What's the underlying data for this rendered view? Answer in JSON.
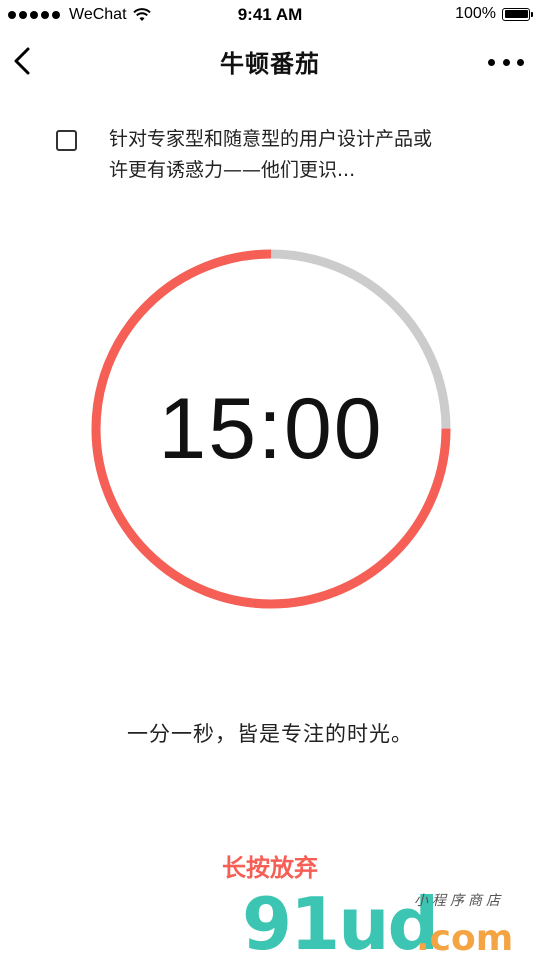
{
  "status_bar": {
    "carrier": "WeChat",
    "time": "9:41 AM",
    "battery": "100%"
  },
  "nav": {
    "title": "牛顿番茄",
    "back_icon": "chevron-left-icon",
    "more_icon": "ellipsis-icon"
  },
  "task": {
    "text": "针对专家型和随意型的用户设计产品或许更有诱惑力——他们更识...",
    "checked": false
  },
  "timer": {
    "display": "15:00",
    "progress_fraction": 0.75,
    "colors": {
      "progress": "#f65f55",
      "track": "#cccccc"
    }
  },
  "motto": "一分一秒，皆是专注的时光。",
  "actions": {
    "give_up_label": "长按放弃"
  },
  "watermark": {
    "logo": "91ud",
    "domain": ".com",
    "sub": "小程序商店"
  }
}
